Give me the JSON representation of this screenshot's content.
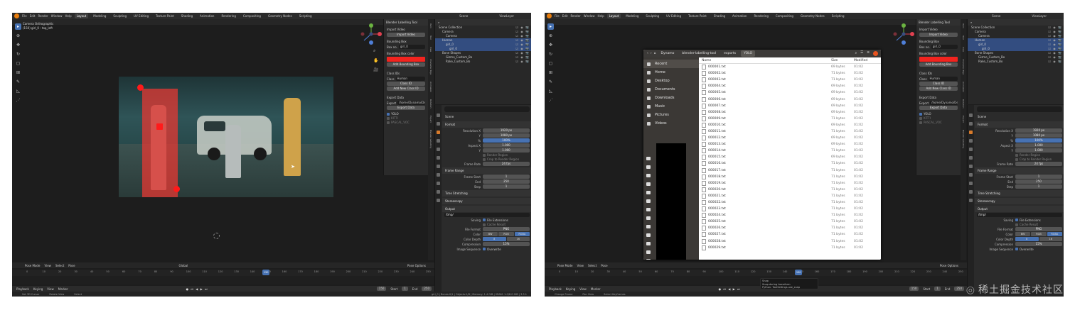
{
  "menu": [
    "File",
    "Edit",
    "Render",
    "Window",
    "Help"
  ],
  "workspaces": [
    "Layout",
    "Modeling",
    "Sculpting",
    "UV Editing",
    "Texture Paint",
    "Shading",
    "Animation",
    "Rendering",
    "Compositing",
    "Geometry Nodes",
    "Scripting"
  ],
  "active_workspace": "Layout",
  "scene": {
    "label": "Scene",
    "view_layer": "ViewLayer"
  },
  "viewport": {
    "camera_title": "Camera Orthographic",
    "camera_sub": "(150) girl_0 : top_left",
    "tools": [
      "cursor-select",
      "cursor",
      "move",
      "rotate",
      "scale",
      "transform",
      "annotate",
      "measure",
      "add"
    ]
  },
  "npanel": {
    "header": "Blender Labelling Tool",
    "import_label": "Import Video",
    "import_button": "Import Video",
    "bbox_label": "Bounding Box",
    "box_no_label": "Box no.",
    "box_no_value": "girl_0",
    "bbox_color_label": "Bounding Box color",
    "bbox_color": "#f2241f",
    "add_box_button": "Add Bounding Box",
    "class_ids_label": "Class IDs",
    "class_label": "Class",
    "class_value": "Human",
    "class_id_field": "Class ID",
    "add_class_button": "Add New Class ID",
    "export_label": "Export Data",
    "export_field": "Export",
    "export_value": "/home/Dynamo/De...",
    "export_button": "Export Data",
    "yolo_label": "YOLO",
    "kitti_label": "KITTI",
    "pascal_label": "PASCAL_VOC"
  },
  "side_tabs": [
    "Item",
    "Tool",
    "View",
    "Character Rigs",
    "Animation",
    "Rotation",
    "Expert",
    "Blender Labelling"
  ],
  "outliner": {
    "title": "Scene Collection",
    "rows": [
      {
        "label": "Scene Collection",
        "indent": 1,
        "selected": false
      },
      {
        "label": "Camera",
        "indent": 2,
        "selected": false
      },
      {
        "label": "Camera",
        "indent": 3,
        "selected": false
      },
      {
        "label": "Human",
        "indent": 2,
        "selected": true
      },
      {
        "label": "girl_0",
        "indent": 3,
        "selected": true
      },
      {
        "label": "girl_0",
        "indent": 4,
        "selected": true
      },
      {
        "label": "Bone Shapes",
        "indent": 2,
        "selected": false
      },
      {
        "label": "Gizmo_Custom_Bo",
        "indent": 3,
        "selected": false
      },
      {
        "label": "Rake_Custom_Bo",
        "indent": 3,
        "selected": false
      }
    ]
  },
  "properties": {
    "scene_label": "Scene",
    "format_section": "Format",
    "rows": [
      {
        "label": "Resolution X",
        "value": "1920 px",
        "style": "gray"
      },
      {
        "label": "Y",
        "value": "1080 px",
        "style": "gray"
      },
      {
        "label": "%",
        "value": "100%",
        "style": "blue"
      },
      {
        "label": "Aspect X",
        "value": "1.000",
        "style": "gray"
      },
      {
        "label": "Y",
        "value": "1.000",
        "style": "gray"
      }
    ],
    "render_region": "Render Region",
    "crop_region": "Crop to Render Region",
    "frame_rate_label": "Frame Rate",
    "frame_rate_value": "24 fps",
    "frame_range_section": "Frame Range",
    "frame_start_label": "Frame Start",
    "frame_start_value": "1",
    "end_label": "End",
    "end_value": "250",
    "step_label": "Step",
    "step_value": "1",
    "time_stretching": "Time Stretching",
    "stereoscopy": "Stereoscopy",
    "output_section": "Output",
    "output_path": "/tmp/",
    "saving_label": "Saving",
    "file_ext": "File Extensions",
    "cache_result": "Cache Result",
    "file_format_label": "File Format",
    "file_format_value": "PNG",
    "color_label": "Color",
    "color_opts": [
      "BW",
      "RGB",
      "RGBA"
    ],
    "color_depth_label": "Color Depth",
    "color_depth_opts": [
      "8",
      "16"
    ],
    "compression_label": "Compression",
    "compression_value": "15%",
    "image_seq_label": "Image Sequence",
    "overwrite": "Overwrite"
  },
  "timeline": {
    "menus": [
      "Pose Mode",
      "View",
      "Select",
      "Pose"
    ],
    "transform": "Global",
    "pose_options": "Pose Options",
    "ticks": [
      "0",
      "10",
      "20",
      "30",
      "40",
      "50",
      "60",
      "70",
      "80",
      "90",
      "100",
      "110",
      "120",
      "130",
      "140",
      "150",
      "160",
      "170",
      "180",
      "190",
      "200",
      "210",
      "220",
      "230",
      "240",
      "250"
    ],
    "current_frame": "150",
    "current_frame_value": 150,
    "playback": "Playback",
    "keying": "Keying",
    "view": "View",
    "marker": "Marker",
    "frame_box": "150",
    "start_label": "Start",
    "start_value": "1",
    "end_label": "End",
    "end_value": "250"
  },
  "status": {
    "left": "Set 3D Cursor",
    "mid": "Rotate View",
    "right": "Select",
    "version": "girl_0 | Bones:0/1 | Objects:1/8 | Memory: 1.4 GiB | VRAM: 1.0/8.0 GiB | 3.3.1"
  },
  "status2": {
    "left": "Change Frame",
    "mid": "Pan View",
    "right": "Select Keyframes"
  },
  "filebrowser": {
    "crumbs": [
      "Dynamo",
      "blender-labelling-tool",
      "exports",
      "YOLO"
    ],
    "places": [
      "Recent",
      "Home",
      "Desktop",
      "Documents",
      "Downloads",
      "Music",
      "Pictures",
      "Videos"
    ],
    "col_name": "Name",
    "col_size": "Size",
    "col_modified": "Modified",
    "files": [
      {
        "name": "000001.txt",
        "size": "69 bytes",
        "mod": "01:02"
      },
      {
        "name": "000002.txt",
        "size": "71 bytes",
        "mod": "01:02"
      },
      {
        "name": "000003.txt",
        "size": "71 bytes",
        "mod": "01:02"
      },
      {
        "name": "000004.txt",
        "size": "69 bytes",
        "mod": "01:02"
      },
      {
        "name": "000005.txt",
        "size": "69 bytes",
        "mod": "01:02"
      },
      {
        "name": "000006.txt",
        "size": "69 bytes",
        "mod": "01:02"
      },
      {
        "name": "000007.txt",
        "size": "69 bytes",
        "mod": "01:02"
      },
      {
        "name": "000008.txt",
        "size": "69 bytes",
        "mod": "01:02"
      },
      {
        "name": "000009.txt",
        "size": "71 bytes",
        "mod": "01:02"
      },
      {
        "name": "000010.txt",
        "size": "69 bytes",
        "mod": "01:02"
      },
      {
        "name": "000011.txt",
        "size": "71 bytes",
        "mod": "01:02"
      },
      {
        "name": "000012.txt",
        "size": "69 bytes",
        "mod": "01:02"
      },
      {
        "name": "000013.txt",
        "size": "69 bytes",
        "mod": "01:02"
      },
      {
        "name": "000014.txt",
        "size": "71 bytes",
        "mod": "01:02"
      },
      {
        "name": "000015.txt",
        "size": "69 bytes",
        "mod": "01:02"
      },
      {
        "name": "000016.txt",
        "size": "71 bytes",
        "mod": "01:02"
      },
      {
        "name": "000017.txt",
        "size": "71 bytes",
        "mod": "01:02"
      },
      {
        "name": "000018.txt",
        "size": "71 bytes",
        "mod": "01:02"
      },
      {
        "name": "000019.txt",
        "size": "71 bytes",
        "mod": "01:02"
      },
      {
        "name": "000020.txt",
        "size": "71 bytes",
        "mod": "01:02"
      },
      {
        "name": "000021.txt",
        "size": "71 bytes",
        "mod": "01:02"
      },
      {
        "name": "000022.txt",
        "size": "71 bytes",
        "mod": "01:02"
      },
      {
        "name": "000023.txt",
        "size": "71 bytes",
        "mod": "01:02"
      },
      {
        "name": "000024.txt",
        "size": "71 bytes",
        "mod": "01:02"
      },
      {
        "name": "000025.txt",
        "size": "71 bytes",
        "mod": "01:02"
      },
      {
        "name": "000026.txt",
        "size": "71 bytes",
        "mod": "01:02"
      },
      {
        "name": "000027.txt",
        "size": "71 bytes",
        "mod": "01:02"
      },
      {
        "name": "000028.txt",
        "size": "71 bytes",
        "mod": "01:02"
      },
      {
        "name": "000029.txt",
        "size": "71 bytes",
        "mod": "01:02"
      }
    ]
  },
  "tooltip": {
    "title": "Snap",
    "desc": "Snap during transform",
    "py": "Python: ToolSettings.use_snap"
  },
  "watermark": {
    "logo": "◎",
    "text": "稀土掘金技术社区"
  },
  "colors": {
    "accent": "#4772b3",
    "bbox": "#f2241f",
    "selected_row": "#334d80"
  }
}
